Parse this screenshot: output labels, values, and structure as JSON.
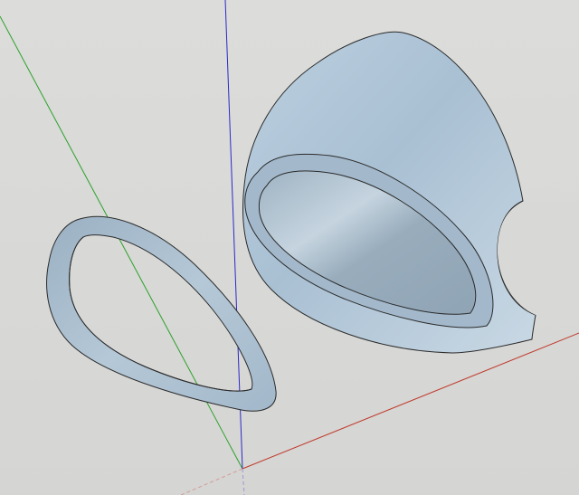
{
  "scene": {
    "background_color": "#d8d8d6",
    "axis_colors": {
      "red_axis": "#c0392b",
      "green_axis": "#2aa12a",
      "blue_axis": "#2a2ac8"
    },
    "objects": [
      {
        "name": "helmet-shell",
        "kind": "dome shell with oval opening",
        "color": "#a9c0d3"
      },
      {
        "name": "visor-ring",
        "kind": "oval ring part",
        "color": "#9fb6c9"
      }
    ]
  }
}
